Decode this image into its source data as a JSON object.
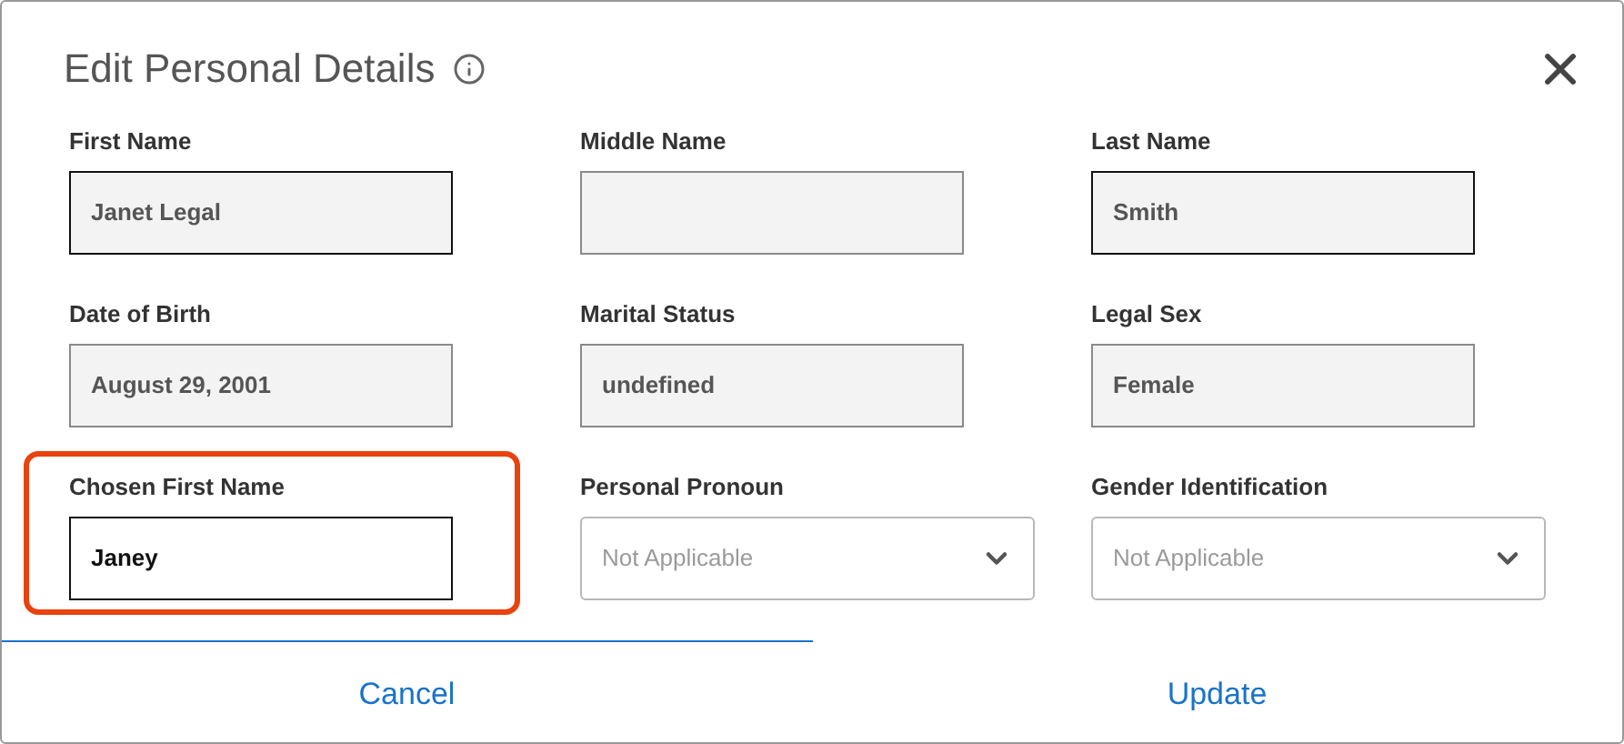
{
  "dialog": {
    "title": "Edit Personal Details"
  },
  "fields": [
    {
      "label": "First Name",
      "kind": "text",
      "value": "Janet Legal",
      "readonly": true,
      "emphasized": true,
      "highlighted": false
    },
    {
      "label": "Middle Name",
      "kind": "text",
      "readonly": true,
      "emphasized": false,
      "highlighted": false
    },
    {
      "label": "Last Name",
      "kind": "text",
      "value": "Smith",
      "readonly": true,
      "emphasized": true,
      "highlighted": false
    },
    {
      "label": "Date of Birth",
      "kind": "text",
      "value": "August 29, 2001",
      "readonly": true,
      "emphasized": false,
      "highlighted": false
    },
    {
      "label": "Marital Status",
      "kind": "text",
      "value": "undefined",
      "readonly": true,
      "emphasized": false,
      "highlighted": false
    },
    {
      "label": "Legal Sex",
      "kind": "text",
      "value": "Female",
      "readonly": true,
      "emphasized": false,
      "highlighted": false
    },
    {
      "label": "Chosen First Name",
      "kind": "text",
      "value": "Janey",
      "readonly": false,
      "emphasized": true,
      "highlighted": true
    },
    {
      "label": "Personal Pronoun",
      "kind": "select",
      "placeholder": "Not Applicable"
    },
    {
      "label": "Gender Identification",
      "kind": "select",
      "placeholder": "Not Applicable"
    }
  ],
  "actions": [
    {
      "label": "Cancel",
      "selected": true
    },
    {
      "label": "Update",
      "selected": false
    }
  ]
}
